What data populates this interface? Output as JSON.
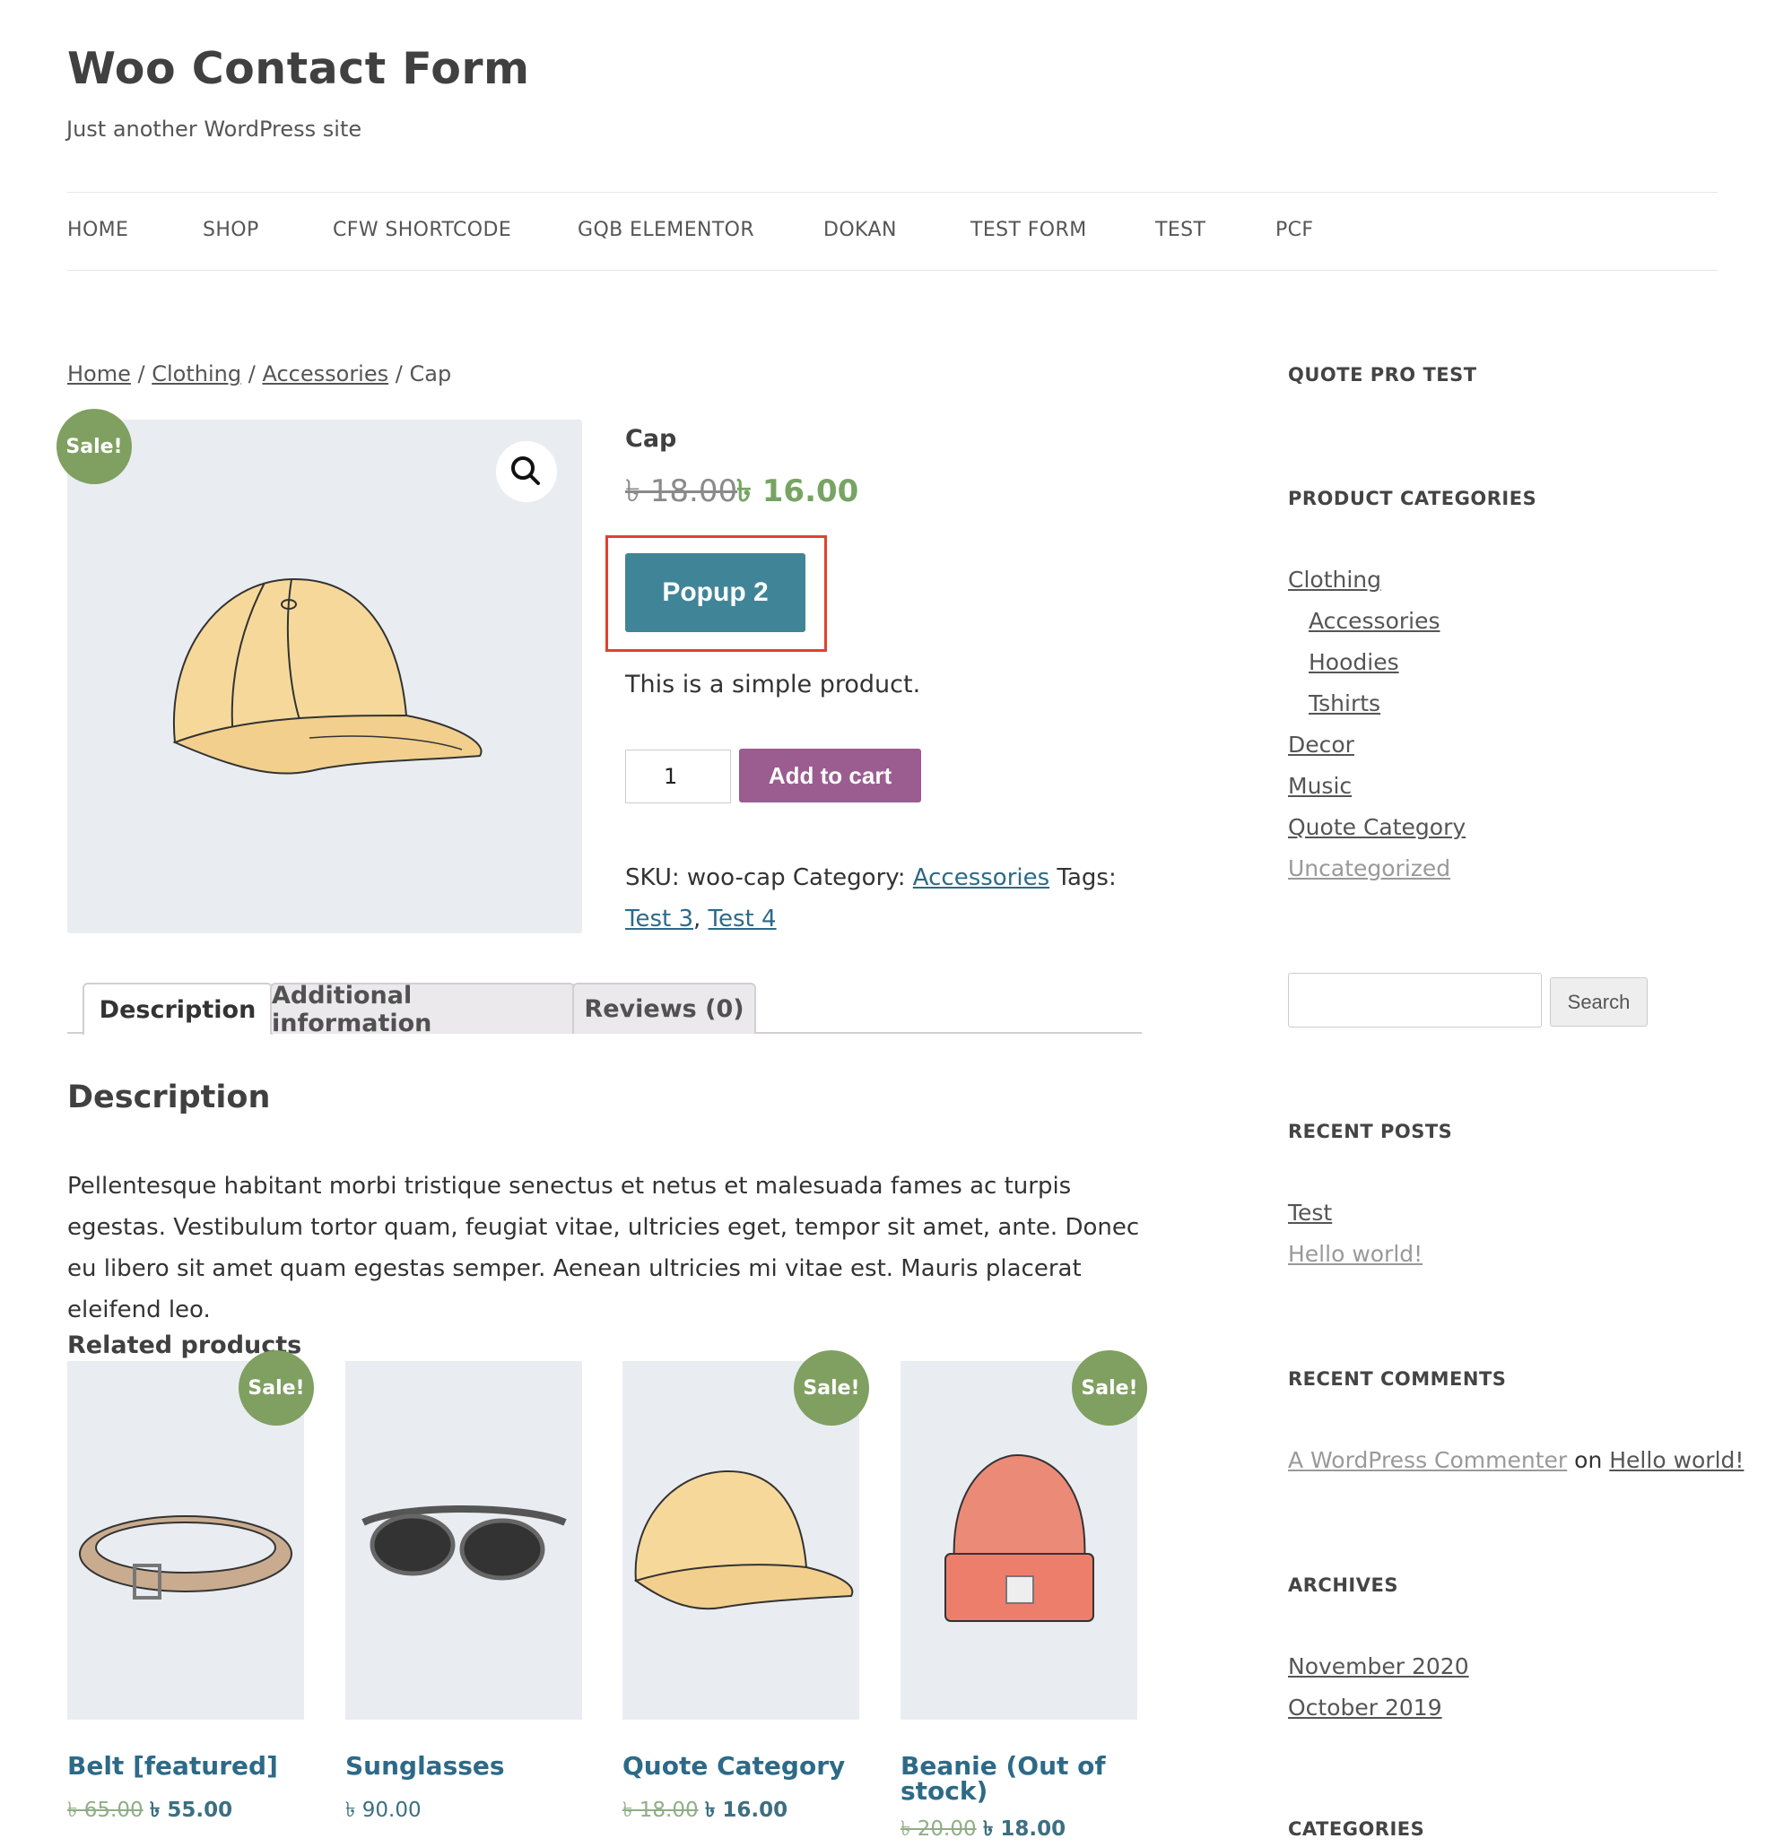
{
  "site": {
    "title": "Woo Contact Form",
    "tagline": "Just another WordPress site"
  },
  "nav": [
    "HOME",
    "SHOP",
    "CFW SHORTCODE",
    "GQB ELEMENTOR",
    "DOKAN",
    "TEST FORM",
    "TEST",
    "PCF"
  ],
  "breadcrumb": {
    "home": "Home",
    "sep": "/",
    "clothing": "Clothing",
    "accessories": "Accessories",
    "current": "Cap"
  },
  "product": {
    "sale_badge": "Sale!",
    "title": "Cap",
    "price_old": "৳ 18.00",
    "price_new": "৳ 16.00",
    "popup_button": "Popup 2",
    "short_description": "This is a simple product.",
    "quantity": "1",
    "add_to_cart": "Add to cart",
    "sku_label": "SKU:",
    "sku": "woo-cap",
    "category_label": "Category:",
    "category": "Accessories",
    "tags_label": "Tags:",
    "tags": [
      "Test 3",
      "Test 4"
    ],
    "tag_sep": ","
  },
  "tabs": [
    "Description",
    "Additional information",
    "Reviews (0)"
  ],
  "description": {
    "heading": "Description",
    "text": "Pellentesque habitant morbi tristique senectus et netus et malesuada fames ac turpis egestas. Vestibulum tortor quam, feugiat vitae, ultricies eget, tempor sit amet, ante. Donec eu libero sit amet quam egestas semper. Aenean ultricies mi vitae est. Mauris placerat eleifend leo."
  },
  "related": {
    "heading": "Related products",
    "items": [
      {
        "title": "Belt [featured]",
        "price_old": "৳ 65.00",
        "price_new": "৳ 55.00",
        "sale": "Sale!"
      },
      {
        "title": "Sunglasses",
        "price": "৳ 90.00"
      },
      {
        "title": "Quote Category",
        "price_old": "৳ 18.00",
        "price_new": "৳ 16.00",
        "sale": "Sale!"
      },
      {
        "title_line1": "Beanie (Out of",
        "title_line2": "stock)",
        "price_old": "৳ 20.00",
        "price_new": "৳ 18.00",
        "sale": "Sale!"
      }
    ]
  },
  "sidebar": {
    "quote_pro_title": "QUOTE PRO TEST",
    "categories_title": "PRODUCT CATEGORIES",
    "categories": [
      "Clothing",
      "Accessories",
      "Hoodies",
      "Tshirts",
      "Decor",
      "Music",
      "Quote Category",
      "Uncategorized"
    ],
    "search_button": "Search",
    "recent_posts_title": "RECENT POSTS",
    "recent_posts": [
      "Test",
      "Hello world!"
    ],
    "recent_comments_title": "RECENT COMMENTS",
    "comment_author": "A WordPress Commenter",
    "comment_on": "on",
    "comment_post": "Hello world!",
    "archives_title": "ARCHIVES",
    "archives": [
      "November 2020",
      "October 2019"
    ],
    "categories_widget_title": "CATEGORIES"
  },
  "colors": {
    "sale_badge": "#7fa060",
    "popup_button": "#3f8597",
    "add_to_cart": "#9b5c8f",
    "price_sale": "#77a464",
    "link": "#2d6a87",
    "highlight_outline": "#e0422e"
  }
}
